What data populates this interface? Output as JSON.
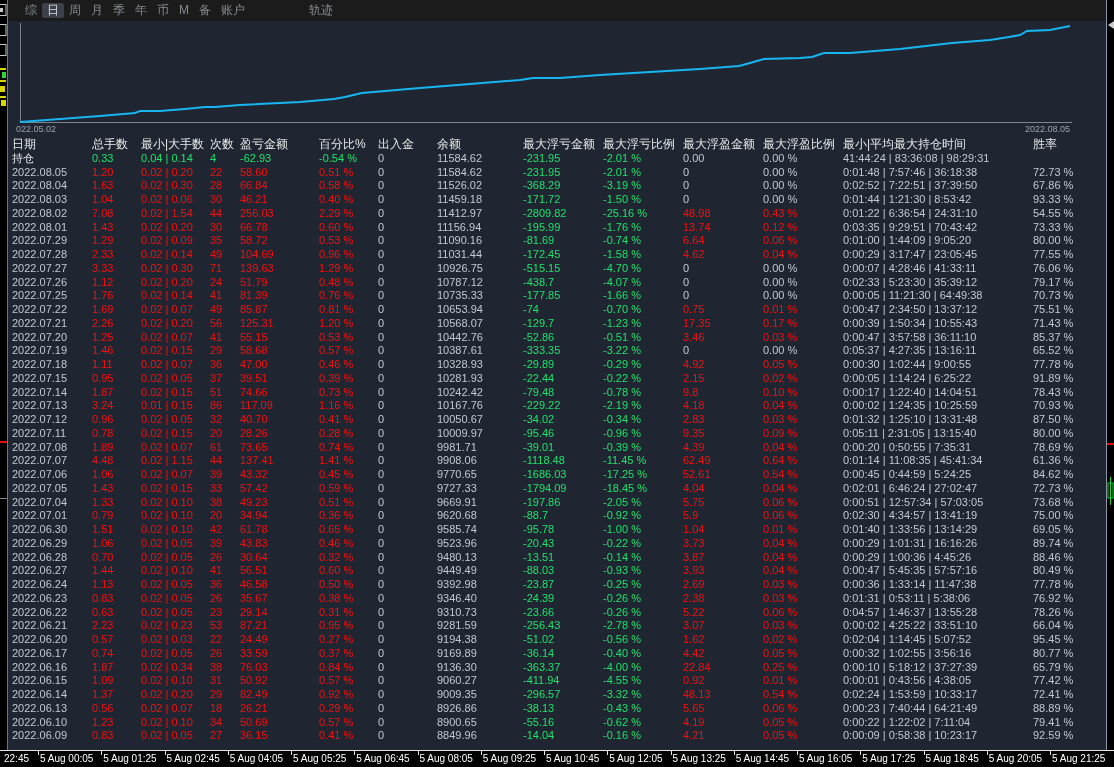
{
  "toolbar": {
    "tabs": [
      {
        "label": "综",
        "selected": false
      },
      {
        "label": "日",
        "selected": true
      },
      {
        "label": "周",
        "selected": false
      },
      {
        "label": "月",
        "selected": false
      },
      {
        "label": "季",
        "selected": false
      },
      {
        "label": "年",
        "selected": false
      },
      {
        "label": "币",
        "selected": false
      },
      {
        "label": "M",
        "selected": false
      },
      {
        "label": "备",
        "selected": false
      },
      {
        "label": "账户",
        "selected": false
      }
    ],
    "view_tabs": [
      {
        "label": "轨迹",
        "selected": false
      }
    ]
  },
  "chart": {
    "start_label": "022.05.02",
    "end_label": "2022.08.05"
  },
  "table": {
    "columns": [
      "日期",
      "总手数",
      "最小|大手数",
      "次数",
      "盈亏金额",
      "百分比%",
      "出入金",
      "余额",
      "最大浮亏金额",
      "最大浮亏比例",
      "最大浮盈金额",
      "最大浮盈比例",
      "最小|平均最大持仓时间",
      "胜率"
    ],
    "rows": [
      {
        "kind": "holding",
        "has_floating_profit": false,
        "cells": [
          "持仓",
          "0.33",
          "0.04 | 0.14",
          "4",
          "-62.93",
          "-0.54 %",
          "0",
          "11584.62",
          "-231.95",
          "-2.01 %",
          "0.00",
          "0.00 %",
          "41:44:24 | 83:36:08 | 98:29:31"
        ]
      },
      {
        "kind": "day",
        "has_floating_profit": false,
        "cells": [
          "2022.08.05",
          "1.20",
          "0.02 | 0.20",
          "22",
          "58.60",
          "0.51 %",
          "0",
          "11584.62",
          "-231.95",
          "-2.01 %",
          "0",
          "0.00 %",
          "0:01:48 | 7:57:46 | 36:18:38",
          "72.73 %"
        ]
      },
      {
        "kind": "day",
        "has_floating_profit": false,
        "cells": [
          "2022.08.04",
          "1.63",
          "0.02 | 0.30",
          "28",
          "66.84",
          "0.58 %",
          "0",
          "11526.02",
          "-368.29",
          "-3.19 %",
          "0",
          "0.00 %",
          "0:02:52 | 7:22:51 | 37:39:50",
          "67.86 %"
        ]
      },
      {
        "kind": "day",
        "has_floating_profit": false,
        "cells": [
          "2022.08.03",
          "1.04",
          "0.02 | 0.06",
          "30",
          "46.21",
          "0.40 %",
          "0",
          "11459.18",
          "-171.72",
          "-1.50 %",
          "0",
          "0.00 %",
          "0:01:44 | 1:21:30 | 8:53:42",
          "93.33 %"
        ]
      },
      {
        "kind": "day",
        "has_floating_profit": true,
        "cells": [
          "2022.08.02",
          "7.08",
          "0.02 | 1.54",
          "44",
          "256.03",
          "2.29 %",
          "0",
          "11412.97",
          "-2809.82",
          "-25.16 %",
          "48.98",
          "0.43 %",
          "0:01:22 | 6:36:54 | 24:31:10",
          "54.55 %"
        ]
      },
      {
        "kind": "day",
        "has_floating_profit": true,
        "cells": [
          "2022.08.01",
          "1.43",
          "0.02 | 0.20",
          "30",
          "66.78",
          "0.60 %",
          "0",
          "11156.94",
          "-195.99",
          "-1.76 %",
          "13.74",
          "0.12 %",
          "0:03:35 | 9:29:51 | 70:43:42",
          "73.33 %"
        ]
      },
      {
        "kind": "day",
        "has_floating_profit": true,
        "cells": [
          "2022.07.29",
          "1.29",
          "0.02 | 0.09",
          "35",
          "58.72",
          "0.53 %",
          "0",
          "11090.16",
          "-81.69",
          "-0.74 %",
          "6.64",
          "0.06 %",
          "0:01:00 | 1:44:09 | 9:05:20",
          "80.00 %"
        ]
      },
      {
        "kind": "day",
        "has_floating_profit": true,
        "cells": [
          "2022.07.28",
          "2.33",
          "0.02 | 0.14",
          "49",
          "104.69",
          "0.96 %",
          "0",
          "11031.44",
          "-172.45",
          "-1.58 %",
          "4.62",
          "0.04 %",
          "0:00:29 | 3:17:47 | 23:05:45",
          "77.55 %"
        ]
      },
      {
        "kind": "day",
        "has_floating_profit": false,
        "cells": [
          "2022.07.27",
          "3.33",
          "0.02 | 0.30",
          "71",
          "139.63",
          "1.29 %",
          "0",
          "10926.75",
          "-515.15",
          "-4.70 %",
          "0",
          "0.00 %",
          "0:00:07 | 4:28:46 | 41:33:11",
          "76.06 %"
        ]
      },
      {
        "kind": "day",
        "has_floating_profit": false,
        "cells": [
          "2022.07.26",
          "1.12",
          "0.02 | 0.20",
          "24",
          "51.79",
          "0.48 %",
          "0",
          "10787.12",
          "-438.7",
          "-4.07 %",
          "0",
          "0.00 %",
          "0:02:33 | 5:23:30 | 35:39:12",
          "79.17 %"
        ]
      },
      {
        "kind": "day",
        "has_floating_profit": false,
        "cells": [
          "2022.07.25",
          "1.76",
          "0.02 | 0.14",
          "41",
          "81.39",
          "0.76 %",
          "0",
          "10735.33",
          "-177.85",
          "-1.66 %",
          "0",
          "0.00 %",
          "0:00:05 | 11:21:30 | 64:49:38",
          "70.73 %"
        ]
      },
      {
        "kind": "day",
        "has_floating_profit": true,
        "cells": [
          "2022.07.22",
          "1.69",
          "0.02 | 0.07",
          "49",
          "85.87",
          "0.81 %",
          "0",
          "10653.94",
          "-74",
          "-0.70 %",
          "0.75",
          "0.01 %",
          "0:00:47 | 2:34:50 | 13:37:12",
          "75.51 %"
        ]
      },
      {
        "kind": "day",
        "has_floating_profit": true,
        "cells": [
          "2022.07.21",
          "2.26",
          "0.02 | 0.20",
          "56",
          "125.31",
          "1.20 %",
          "0",
          "10568.07",
          "-129.7",
          "-1.23 %",
          "17.35",
          "0.17 %",
          "0:00:39 | 1:50:34 | 10:55:43",
          "71.43 %"
        ]
      },
      {
        "kind": "day",
        "has_floating_profit": true,
        "cells": [
          "2022.07.20",
          "1.25",
          "0.02 | 0.07",
          "41",
          "55.15",
          "0.53 %",
          "0",
          "10442.76",
          "-52.86",
          "-0.51 %",
          "3.46",
          "0.03 %",
          "0:00:47 | 3:57:58 | 36:11:10",
          "85.37 %"
        ]
      },
      {
        "kind": "day",
        "has_floating_profit": false,
        "cells": [
          "2022.07.19",
          "1.46",
          "0.02 | 0.15",
          "29",
          "58.68",
          "0.57 %",
          "0",
          "10387.61",
          "-333.35",
          "-3.22 %",
          "0",
          "0.00 %",
          "0:05:37 | 4:27:35 | 13:16:11",
          "65.52 %"
        ]
      },
      {
        "kind": "day",
        "has_floating_profit": true,
        "cells": [
          "2022.07.18",
          "1.11",
          "0.02 | 0.07",
          "36",
          "47.00",
          "0.46 %",
          "0",
          "10328.93",
          "-29.89",
          "-0.29 %",
          "4.92",
          "0.05 %",
          "0:00:30 | 1:02:44 | 9:00:55",
          "77.78 %"
        ]
      },
      {
        "kind": "day",
        "has_floating_profit": true,
        "cells": [
          "2022.07.15",
          "0.95",
          "0.02 | 0.05",
          "37",
          "39.51",
          "0.39 %",
          "0",
          "10281.93",
          "-22.44",
          "-0.22 %",
          "2.15",
          "0.02 %",
          "0:00:05 | 1:14:24 | 6:25:22",
          "91.89 %"
        ]
      },
      {
        "kind": "day",
        "has_floating_profit": true,
        "cells": [
          "2022.07.14",
          "1.87",
          "0.02 | 0.15",
          "51",
          "74.66",
          "0.73 %",
          "0",
          "10242.42",
          "-79.48",
          "-0.78 %",
          "9.8",
          "0.10 %",
          "0:00:17 | 1:22:40 | 14:04:51",
          "78.43 %"
        ]
      },
      {
        "kind": "day",
        "has_floating_profit": true,
        "cells": [
          "2022.07.13",
          "3.24",
          "0.01 | 0.15",
          "86",
          "117.09",
          "1.16 %",
          "0",
          "10167.76",
          "-229.22",
          "-2.19 %",
          "4.18",
          "0.04 %",
          "0:00:02 | 1:24:35 | 10:25:59",
          "70.93 %"
        ]
      },
      {
        "kind": "day",
        "has_floating_profit": true,
        "cells": [
          "2022.07.12",
          "0.96",
          "0.02 | 0.05",
          "32",
          "40.70",
          "0.41 %",
          "0",
          "10050.67",
          "-34.02",
          "-0.34 %",
          "2.83",
          "0.03 %",
          "0:01:32 | 1:25:10 | 13:31:48",
          "87.50 %"
        ]
      },
      {
        "kind": "day",
        "has_floating_profit": true,
        "cells": [
          "2022.07.11",
          "0.78",
          "0.02 | 0.15",
          "20",
          "28.26",
          "0.28 %",
          "0",
          "10009.97",
          "-95.46",
          "-0.96 %",
          "9.35",
          "0.09 %",
          "0:05:11 | 2:31:05 | 13:15:40",
          "80.00 %"
        ]
      },
      {
        "kind": "day",
        "has_floating_profit": true,
        "cells": [
          "2022.07.08",
          "1.89",
          "0.02 | 0.07",
          "61",
          "73.65",
          "0.74 %",
          "0",
          "9981.71",
          "-39.01",
          "-0.39 %",
          "4.39",
          "0.04 %",
          "0:00:20 | 0:50:55 | 7:35:31",
          "78.69 %"
        ]
      },
      {
        "kind": "day",
        "has_floating_profit": true,
        "cells": [
          "2022.07.07",
          "4.48",
          "0.02 | 1.15",
          "44",
          "137.41",
          "1.41 %",
          "0",
          "9908.06",
          "-1118.48",
          "-11.45 %",
          "62.49",
          "0.64 %",
          "0:01:14 | 11:08:35 | 45:41:34",
          "61.36 %"
        ]
      },
      {
        "kind": "day",
        "has_floating_profit": true,
        "cells": [
          "2022.07.06",
          "1.06",
          "0.02 | 0.07",
          "39",
          "43.32",
          "0.45 %",
          "0",
          "9770.65",
          "-1686.03",
          "-17.25 %",
          "52.61",
          "0.54 %",
          "0:00:45 | 0:44:59 | 5:24:25",
          "84.62 %"
        ]
      },
      {
        "kind": "day",
        "has_floating_profit": true,
        "cells": [
          "2022.07.05",
          "1.43",
          "0.02 | 0.15",
          "33",
          "57.42",
          "0.59 %",
          "0",
          "9727.33",
          "-1794.09",
          "-18.45 %",
          "4.04",
          "0.04 %",
          "0:02:01 | 6:46:24 | 27:02:47",
          "72.73 %"
        ]
      },
      {
        "kind": "day",
        "has_floating_profit": true,
        "cells": [
          "2022.07.04",
          "1.33",
          "0.02 | 0.10",
          "38",
          "49.23",
          "0.51 %",
          "0",
          "9669.91",
          "-197.86",
          "-2.05 %",
          "5.75",
          "0.06 %",
          "0:00:51 | 12:57:34 | 57:03:05",
          "73.68 %"
        ]
      },
      {
        "kind": "day",
        "has_floating_profit": true,
        "cells": [
          "2022.07.01",
          "0.79",
          "0.02 | 0.10",
          "20",
          "34.94",
          "0.36 %",
          "0",
          "9620.68",
          "-88.7",
          "-0.92 %",
          "5.9",
          "0.06 %",
          "0:02:30 | 4:34:57 | 13:41:19",
          "75.00 %"
        ]
      },
      {
        "kind": "day",
        "has_floating_profit": true,
        "cells": [
          "2022.06.30",
          "1.51",
          "0.02 | 0.10",
          "42",
          "61.78",
          "0.65 %",
          "0",
          "9585.74",
          "-95.78",
          "-1.00 %",
          "1.04",
          "0.01 %",
          "0:01:40 | 1:33:56 | 13:14:29",
          "69.05 %"
        ]
      },
      {
        "kind": "day",
        "has_floating_profit": true,
        "cells": [
          "2022.06.29",
          "1.06",
          "0.02 | 0.05",
          "39",
          "43.83",
          "0.46 %",
          "0",
          "9523.96",
          "-20.43",
          "-0.22 %",
          "3.73",
          "0.04 %",
          "0:00:29 | 1:01:31 | 16:16:26",
          "89.74 %"
        ]
      },
      {
        "kind": "day",
        "has_floating_profit": true,
        "cells": [
          "2022.06.28",
          "0.70",
          "0.02 | 0.05",
          "26",
          "30.64",
          "0.32 %",
          "0",
          "9480.13",
          "-13.51",
          "-0.14 %",
          "3.87",
          "0.04 %",
          "0:00:29 | 1:00:36 | 4:45:26",
          "88.46 %"
        ]
      },
      {
        "kind": "day",
        "has_floating_profit": true,
        "cells": [
          "2022.06.27",
          "1.44",
          "0.02 | 0.10",
          "41",
          "56.51",
          "0.60 %",
          "0",
          "9449.49",
          "-88.03",
          "-0.93 %",
          "3.93",
          "0.04 %",
          "0:00:47 | 5:45:35 | 57:57:16",
          "80.49 %"
        ]
      },
      {
        "kind": "day",
        "has_floating_profit": true,
        "cells": [
          "2022.06.24",
          "1.13",
          "0.02 | 0.05",
          "36",
          "46.58",
          "0.50 %",
          "0",
          "9392.98",
          "-23.87",
          "-0.25 %",
          "2.69",
          "0.03 %",
          "0:00:36 | 1:33:14 | 11:47:38",
          "77.78 %"
        ]
      },
      {
        "kind": "day",
        "has_floating_profit": true,
        "cells": [
          "2022.06.23",
          "0.83",
          "0.02 | 0.05",
          "26",
          "35.67",
          "0.38 %",
          "0",
          "9346.40",
          "-24.39",
          "-0.26 %",
          "2.38",
          "0.03 %",
          "0:01:31 | 0:53:11 | 5:38:06",
          "76.92 %"
        ]
      },
      {
        "kind": "day",
        "has_floating_profit": true,
        "cells": [
          "2022.06.22",
          "0.63",
          "0.02 | 0.05",
          "23",
          "29.14",
          "0.31 %",
          "0",
          "9310.73",
          "-23.66",
          "-0.26 %",
          "5.22",
          "0.06 %",
          "0:04:57 | 1:46:37 | 13:55:28",
          "78.26 %"
        ]
      },
      {
        "kind": "day",
        "has_floating_profit": true,
        "cells": [
          "2022.06.21",
          "2.23",
          "0.02 | 0.23",
          "53",
          "87.21",
          "0.95 %",
          "0",
          "9281.59",
          "-256.43",
          "-2.78 %",
          "3.07",
          "0.03 %",
          "0:00:02 | 4:25:22 | 33:51:10",
          "66.04 %"
        ]
      },
      {
        "kind": "day",
        "has_floating_profit": true,
        "cells": [
          "2022.06.20",
          "0.57",
          "0.02 | 0.03",
          "22",
          "24.49",
          "0.27 %",
          "0",
          "9194.38",
          "-51.02",
          "-0.56 %",
          "1.62",
          "0.02 %",
          "0:02:04 | 1:14:45 | 5:07:52",
          "95.45 %"
        ]
      },
      {
        "kind": "day",
        "has_floating_profit": true,
        "cells": [
          "2022.06.17",
          "0.74",
          "0.02 | 0.05",
          "26",
          "33.59",
          "0.37 %",
          "0",
          "9169.89",
          "-36.14",
          "-0.40 %",
          "4.42",
          "0.05 %",
          "0:00:32 | 1:02:55 | 3:56:16",
          "80.77 %"
        ]
      },
      {
        "kind": "day",
        "has_floating_profit": true,
        "cells": [
          "2022.06.16",
          "1.87",
          "0.02 | 0.34",
          "38",
          "76.03",
          "0.84 %",
          "0",
          "9136.30",
          "-363.37",
          "-4.00 %",
          "22.84",
          "0.25 %",
          "0:00:10 | 5:18:12 | 37:27:39",
          "65.79 %"
        ]
      },
      {
        "kind": "day",
        "has_floating_profit": true,
        "cells": [
          "2022.06.15",
          "1.09",
          "0.02 | 0.10",
          "31",
          "50.92",
          "0.57 %",
          "0",
          "9060.27",
          "-411.94",
          "-4.55 %",
          "0.92",
          "0.01 %",
          "0:00:01 | 0:43:56 | 4:38:05",
          "77.42 %"
        ]
      },
      {
        "kind": "day",
        "has_floating_profit": true,
        "cells": [
          "2022.06.14",
          "1.37",
          "0.02 | 0.20",
          "29",
          "82.49",
          "0.92 %",
          "0",
          "9009.35",
          "-296.57",
          "-3.32 %",
          "48.13",
          "0.54 %",
          "0:02:24 | 1:53:59 | 10:33:17",
          "72.41 %"
        ]
      },
      {
        "kind": "day",
        "has_floating_profit": true,
        "cells": [
          "2022.06.13",
          "0.56",
          "0.02 | 0.07",
          "18",
          "26.21",
          "0.29 %",
          "0",
          "8926.86",
          "-38.13",
          "-0.43 %",
          "5.65",
          "0.06 %",
          "0:00:23 | 7:40:44 | 64:21:49",
          "88.89 %"
        ]
      },
      {
        "kind": "day",
        "has_floating_profit": true,
        "cells": [
          "2022.06.10",
          "1.23",
          "0.02 | 0.10",
          "34",
          "50.69",
          "0.57 %",
          "0",
          "8900.65",
          "-55.16",
          "-0.62 %",
          "4.19",
          "0.05 %",
          "0:00:22 | 1:22:02 | 7:11:04",
          "79.41 %"
        ]
      },
      {
        "kind": "day",
        "has_floating_profit": true,
        "cells": [
          "2022.06.09",
          "0.83",
          "0.02 | 0.05",
          "27",
          "36.15",
          "0.41 %",
          "0",
          "8849.96",
          "-14.04",
          "-0.16 %",
          "4.21",
          "0.05 %",
          "0:00:09 | 0:58:38 | 10:23:17",
          "92.59 %"
        ]
      }
    ]
  },
  "time_axis": {
    "labels": [
      "22:45",
      "5 Aug 00:05",
      "5 Aug 01:25",
      "5 Aug 02:45",
      "5 Aug 04:05",
      "5 Aug 05:25",
      "5 Aug 06:45",
      "5 Aug 08:05",
      "5 Aug 09:25",
      "5 Aug 10:45",
      "5 Aug 12:05",
      "5 Aug 13:25",
      "5 Aug 14:45",
      "5 Aug 16:05",
      "5 Aug 17:25",
      "5 Aug 18:45",
      "5 Aug 20:05",
      "5 Aug 21:25"
    ]
  }
}
